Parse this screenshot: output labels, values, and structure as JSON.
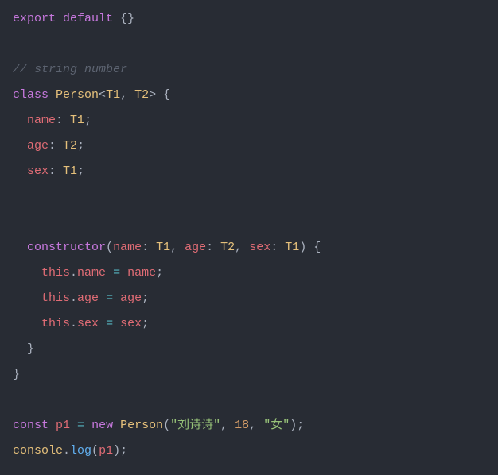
{
  "line01": {
    "export": "export",
    "default": "default",
    "obj": "{}"
  },
  "line03": {
    "comment": "// string number"
  },
  "line04": {
    "class": "class",
    "name": "Person",
    "lt": "<",
    "t1": "T1",
    "comma": ", ",
    "t2": "T2",
    "gt": ">",
    "brace": " {"
  },
  "line05": {
    "indent": "  ",
    "prop": "name",
    "colon": ": ",
    "type": "T1",
    "semi": ";"
  },
  "line06": {
    "indent": "  ",
    "prop": "age",
    "colon": ": ",
    "type": "T2",
    "semi": ";"
  },
  "line07": {
    "indent": "  ",
    "prop": "sex",
    "colon": ": ",
    "type": "T1",
    "semi": ";"
  },
  "line10": {
    "indent": "  ",
    "ctor": "constructor",
    "open": "(",
    "p1": "name",
    "c1": ": ",
    "t1": "T1",
    "s1": ", ",
    "p2": "age",
    "c2": ": ",
    "t2": "T2",
    "s2": ", ",
    "p3": "sex",
    "c3": ": ",
    "t3": "T1",
    "close": ")",
    "brace": " {"
  },
  "line11": {
    "indent": "    ",
    "this": "this",
    "dot": ".",
    "prop": "name",
    "eq": " = ",
    "rhs": "name",
    "semi": ";"
  },
  "line12": {
    "indent": "    ",
    "this": "this",
    "dot": ".",
    "prop": "age",
    "eq": " = ",
    "rhs": "age",
    "semi": ";"
  },
  "line13": {
    "indent": "    ",
    "this": "this",
    "dot": ".",
    "prop": "sex",
    "eq": " = ",
    "rhs": "sex",
    "semi": ";"
  },
  "line14": {
    "indent": "  ",
    "brace": "}"
  },
  "line15": {
    "brace": "}"
  },
  "line17": {
    "const": "const",
    "var": "p1",
    "eq": " = ",
    "new": "new",
    "cls": "Person",
    "open": "(",
    "s1": "\"刘诗诗\"",
    "c1": ", ",
    "n1": "18",
    "c2": ", ",
    "s2": "\"女\"",
    "close": ")",
    "semi": ";"
  },
  "line18": {
    "obj": "console",
    "dot": ".",
    "fn": "log",
    "open": "(",
    "arg": "p1",
    "close": ")",
    "semi": ";"
  }
}
